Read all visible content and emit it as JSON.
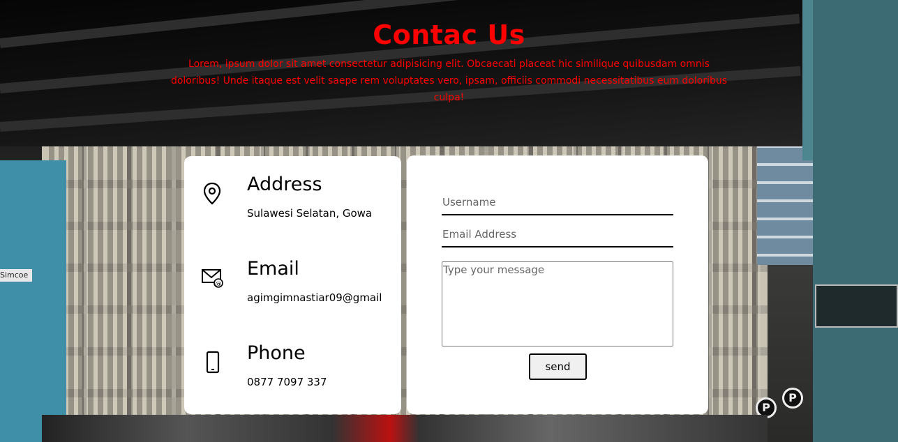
{
  "header": {
    "title": "Contac Us",
    "subtitle": "Lorem, ipsum dolor sit amet consectetur adipisicing elit. Obcaecati placeat hic similique quibusdam omnis doloribus! Unde itaque est velit saepe rem voluptates vero, ipsam, officiis commodi necessitatibus eum doloribus culpa!"
  },
  "info": {
    "address": {
      "icon": "location-pin-icon",
      "title": "Address",
      "value": "Sulawesi Selatan, Gowa"
    },
    "email": {
      "icon": "mail-icon",
      "title": "Email",
      "value": "agimgimnastiar09@gmail"
    },
    "phone": {
      "icon": "phone-icon",
      "title": "Phone",
      "value": "0877 7097 337"
    }
  },
  "form": {
    "username_placeholder": "Username",
    "email_placeholder": "Email Address",
    "message_placeholder": "Type your message",
    "send_label": "send"
  },
  "background": {
    "street_sign": "Simcoe",
    "parking_sign": "P"
  },
  "colors": {
    "accent": "#ff0000",
    "card": "#ffffff"
  }
}
